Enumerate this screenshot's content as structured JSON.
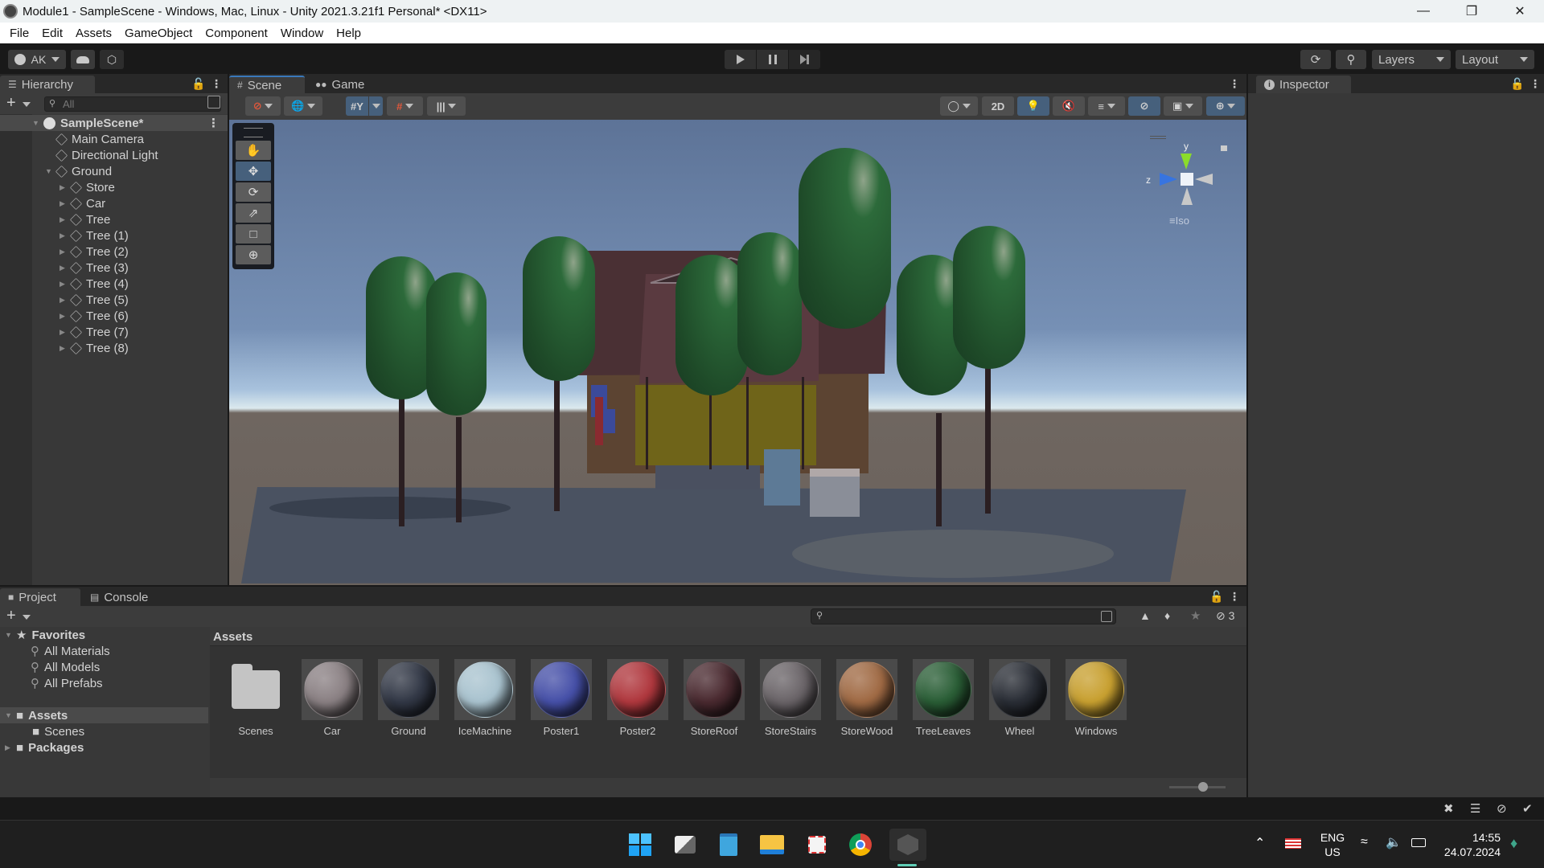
{
  "window": {
    "title": "Module1 - SampleScene - Windows, Mac, Linux - Unity 2021.3.21f1 Personal* <DX11>",
    "controls": [
      "minimize",
      "maximize",
      "close"
    ]
  },
  "menu": [
    "File",
    "Edit",
    "Assets",
    "GameObject",
    "Component",
    "Window",
    "Help"
  ],
  "toolbar": {
    "account": "AK",
    "layers": "Layers",
    "layout": "Layout",
    "play_controls": [
      "play",
      "pause",
      "step"
    ]
  },
  "hierarchy": {
    "tab": "Hierarchy",
    "search_placeholder": "All",
    "scene": "SampleScene*",
    "items": [
      {
        "label": "Main Camera",
        "depth": 1,
        "expandable": false
      },
      {
        "label": "Directional Light",
        "depth": 1,
        "expandable": false
      },
      {
        "label": "Ground",
        "depth": 1,
        "expandable": true,
        "expanded": true
      },
      {
        "label": "Store",
        "depth": 2,
        "expandable": true
      },
      {
        "label": "Car",
        "depth": 2,
        "expandable": true
      },
      {
        "label": "Tree",
        "depth": 2,
        "expandable": true
      },
      {
        "label": "Tree (1)",
        "depth": 2,
        "expandable": true
      },
      {
        "label": "Tree (2)",
        "depth": 2,
        "expandable": true
      },
      {
        "label": "Tree (3)",
        "depth": 2,
        "expandable": true
      },
      {
        "label": "Tree (4)",
        "depth": 2,
        "expandable": true
      },
      {
        "label": "Tree (5)",
        "depth": 2,
        "expandable": true
      },
      {
        "label": "Tree (6)",
        "depth": 2,
        "expandable": true
      },
      {
        "label": "Tree (7)",
        "depth": 2,
        "expandable": true
      },
      {
        "label": "Tree (8)",
        "depth": 2,
        "expandable": true
      }
    ]
  },
  "scene_view": {
    "tabs": [
      "Scene",
      "Game"
    ],
    "active_tab": "Scene",
    "mode_2d": "2D",
    "gizmo": {
      "y_label": "y",
      "z_label": "z",
      "projection": "Iso"
    },
    "tools": [
      "hand",
      "move",
      "rotate",
      "scale",
      "rect",
      "transform"
    ],
    "active_tool": "move"
  },
  "inspector": {
    "tab": "Inspector"
  },
  "project": {
    "tabs": [
      "Project",
      "Console"
    ],
    "active_tab": "Project",
    "favorites_label": "Favorites",
    "favorites": [
      "All Materials",
      "All Models",
      "All Prefabs"
    ],
    "assets_label": "Assets",
    "assets_children": [
      "Scenes"
    ],
    "packages_label": "Packages",
    "breadcrumb": "Assets",
    "hidden_count": "3",
    "assets": [
      {
        "name": "Scenes",
        "type": "folder"
      },
      {
        "name": "Car",
        "type": "material",
        "color": "#8a8083"
      },
      {
        "name": "Ground",
        "type": "material",
        "color": "#323846"
      },
      {
        "name": "IceMachine",
        "type": "material",
        "color": "#a9c3cf"
      },
      {
        "name": "Poster1",
        "type": "material",
        "color": "#4650a8"
      },
      {
        "name": "Poster2",
        "type": "material",
        "color": "#b0383e"
      },
      {
        "name": "StoreRoof",
        "type": "material",
        "color": "#4a2a30"
      },
      {
        "name": "StoreStairs",
        "type": "material",
        "color": "#6a6468"
      },
      {
        "name": "StoreWood",
        "type": "material",
        "color": "#a06a44"
      },
      {
        "name": "TreeLeaves",
        "type": "material",
        "color": "#2a5e36"
      },
      {
        "name": "Wheel",
        "type": "material",
        "color": "#2a2e36"
      },
      {
        "name": "Windows",
        "type": "material",
        "color": "#c8a030"
      }
    ]
  },
  "taskbar": {
    "apps": [
      "start",
      "task-view",
      "notepad",
      "file-explorer",
      "snipping-tool",
      "chrome",
      "unity"
    ],
    "language": "ENG",
    "region": "US",
    "time": "14:55",
    "date": "24.07.2024"
  }
}
